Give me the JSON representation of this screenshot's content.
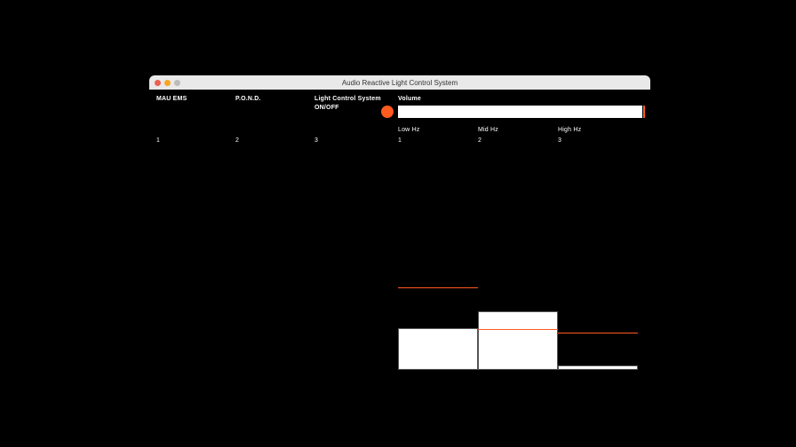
{
  "window": {
    "title": "Audio Reactive Light Control System"
  },
  "header": {
    "col1": "MAU EMS",
    "col2": "P.O.N.D.",
    "col3_line1": "Light Control System",
    "col3_line2": "ON/OFF",
    "col4": "Volume"
  },
  "row2": {
    "c1": "1",
    "c2": "2",
    "c3": "3"
  },
  "freq": {
    "low_label": "Low Hz",
    "mid_label": "Mid Hz",
    "high_label": "High Hz",
    "low_val": "1",
    "mid_val": "2",
    "high_val": "3"
  },
  "colors": {
    "accent": "#ff5a1f"
  },
  "chart_data": {
    "type": "bar",
    "categories": [
      "Low Hz",
      "Mid Hz",
      "High Hz"
    ],
    "values_pct": [
      47,
      66,
      5
    ],
    "markers_pct": [
      93,
      46,
      42
    ],
    "title": "",
    "xlabel": "",
    "ylabel": "",
    "ylim": [
      0,
      100
    ]
  },
  "volume": {
    "value_pct": 98
  }
}
